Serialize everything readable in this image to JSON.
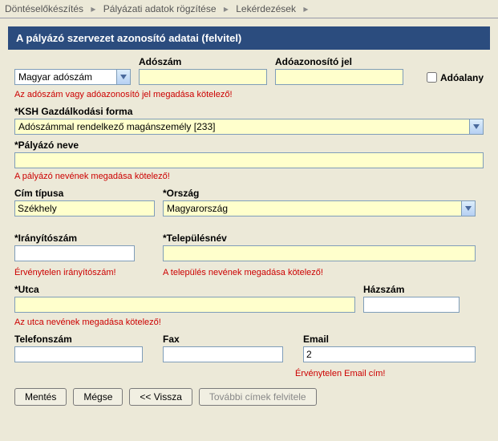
{
  "breadcrumb": {
    "items": [
      "Döntéselőkészítés",
      "Pályázati adatok rögzítése",
      "Lekérdezések"
    ]
  },
  "panel": {
    "title": "A pályázó szervezet azonosító adatai (felvitel)"
  },
  "fields": {
    "adoszam_tipus": {
      "selected": "Magyar adószám"
    },
    "adoszam": {
      "label": "Adószám",
      "value": ""
    },
    "adoazonosito": {
      "label": "Adóazonosító jel",
      "value": ""
    },
    "adoalany": {
      "label": "Adóalany",
      "checked": false
    },
    "ksh": {
      "label": "KSH Gazdálkodási forma",
      "selected": "Adószámmal rendelkező magánszemély [233]"
    },
    "palyazo_neve": {
      "label": "Pályázó neve",
      "value": ""
    },
    "cim_tipusa": {
      "label": "Cím típusa",
      "value": "Székhely"
    },
    "orszag": {
      "label": "Ország",
      "selected": "Magyarország"
    },
    "iranyitoszam": {
      "label": "Irányítószám",
      "value": ""
    },
    "telepulesnev": {
      "label": "Településnév",
      "value": ""
    },
    "utca": {
      "label": "Utca",
      "value": ""
    },
    "hazszam": {
      "label": "Házszám",
      "value": ""
    },
    "telefonszam": {
      "label": "Telefonszám",
      "value": ""
    },
    "fax": {
      "label": "Fax",
      "value": ""
    },
    "email": {
      "label": "Email",
      "value": "2"
    }
  },
  "errors": {
    "adoszam": "Az adószám vagy adóazonosító jel megadása kötelező!",
    "palyazo_neve": "A pályázó nevének megadása kötelező!",
    "iranyitoszam": "Érvénytelen irányítószám!",
    "telepulesnev": "A település nevének megadása kötelező!",
    "utca": "Az utca nevének megadása kötelező!",
    "email": "Érvénytelen Email cím!"
  },
  "buttons": {
    "save": "Mentés",
    "cancel": "Mégse",
    "back": "<< Vissza",
    "more": "További címek felvitele"
  }
}
